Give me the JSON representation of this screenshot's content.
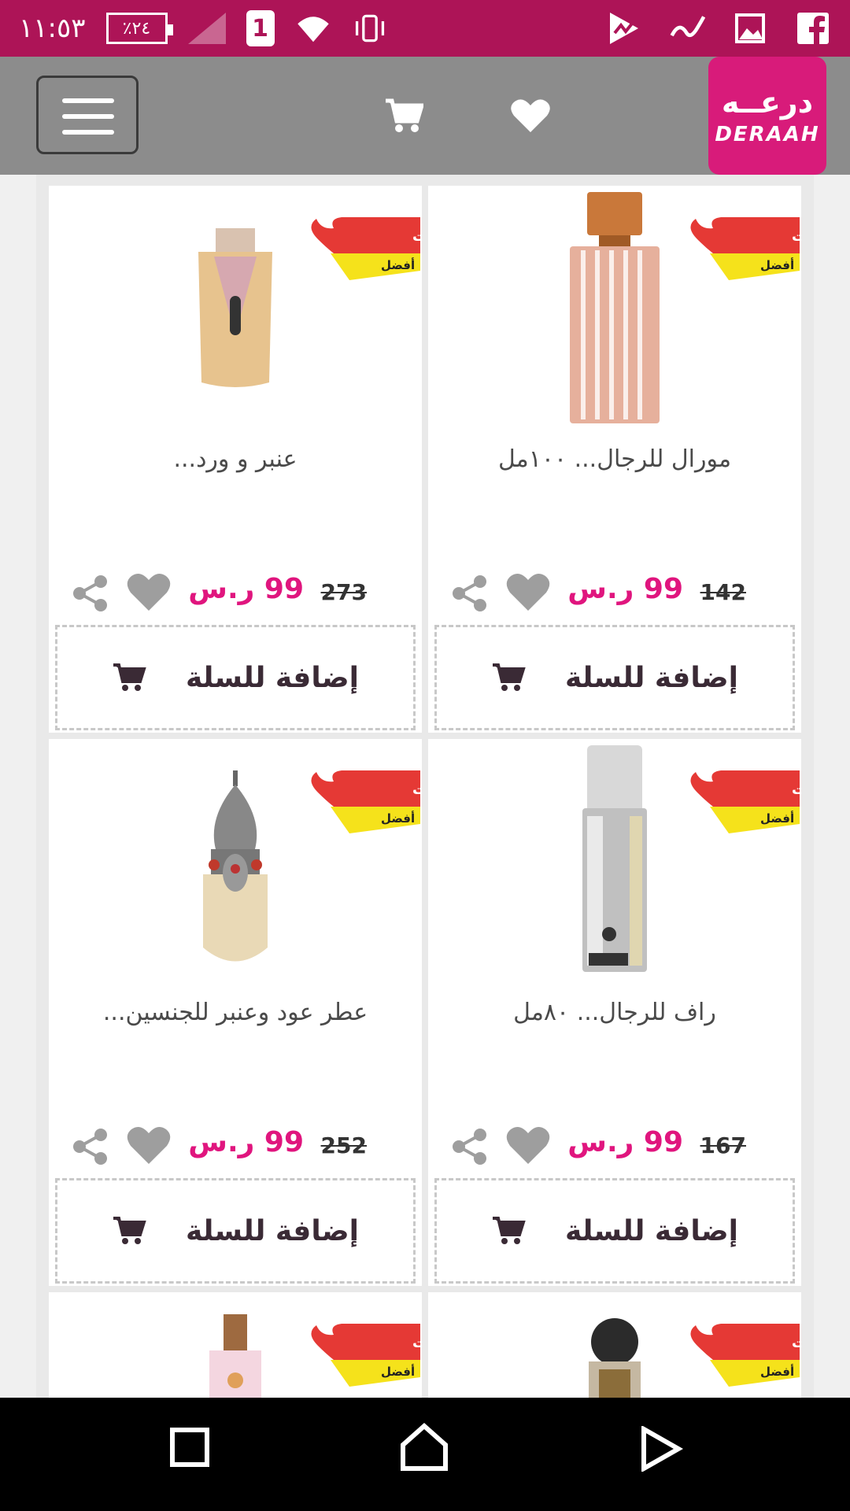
{
  "status_bar": {
    "time": "١١:٥٣",
    "battery": "٪٢٤",
    "sim": "1",
    "icons": [
      "battery-icon",
      "signal-icon",
      "sim-icon",
      "wifi-icon",
      "vibrate-icon",
      "play-store-icon",
      "app-icon",
      "gallery-icon",
      "facebook-icon"
    ]
  },
  "header": {
    "logo_ar": "درعــه",
    "logo_en": "DERAAH",
    "icons": [
      "menu-icon",
      "cart-icon",
      "heart-icon"
    ]
  },
  "products": [
    {
      "title": "مورال للرجال... ١٠٠مل",
      "old_price": "142",
      "new_price": "99 ر.س",
      "badge": "الصفقات أفضل",
      "add_label": "إضافة للسلة",
      "image": "perfume-striped-bottle"
    },
    {
      "title": "عنبر و ورد...",
      "old_price": "273",
      "new_price": "99 ر.س",
      "badge": "الصفقات أفضل",
      "add_label": "إضافة للسلة",
      "image": "perfume-amber-bottle"
    },
    {
      "title": "راف للرجال... ٨٠مل",
      "old_price": "167",
      "new_price": "99 ر.س",
      "badge": "الصفقات أفضل",
      "add_label": "إضافة للسلة",
      "image": "perfume-silver-bottle"
    },
    {
      "title": "عطر عود وعنبر للجنسين...",
      "old_price": "252",
      "new_price": "99 ر.س",
      "badge": "الصفقات أفضل",
      "add_label": "إضافة للسلة",
      "image": "perfume-lantern-bottle"
    },
    {
      "title": "",
      "old_price": "",
      "new_price": "",
      "badge": "الصفقات أفضل",
      "add_label": "",
      "image": "perfume-dark-bottle"
    },
    {
      "title": "",
      "old_price": "",
      "new_price": "",
      "badge": "الصفقات أفضل",
      "add_label": "",
      "image": "perfume-pink-bottle"
    }
  ],
  "badge_text": {
    "top": "الصفقات",
    "bottom": "أفضل"
  },
  "nav": {
    "icons": [
      "recents-icon",
      "home-icon",
      "back-icon"
    ]
  },
  "colors": {
    "status_bar": "#ad1457",
    "accent": "#e0157e",
    "app_bar": "#8c8c8c",
    "logo": "#d81b7a"
  }
}
